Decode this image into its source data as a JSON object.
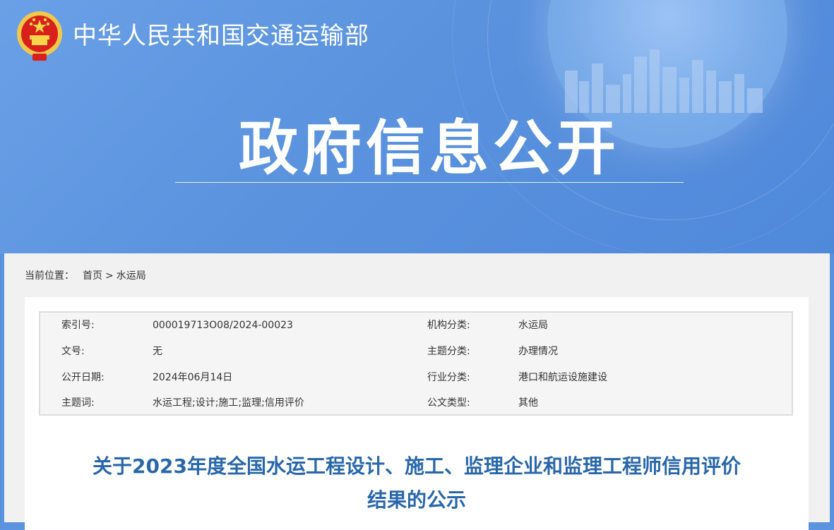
{
  "header": {
    "site_title": "中华人民共和国交通运输部",
    "banner_heading": "政府信息公开",
    "emblem_icon": "national-emblem-icon"
  },
  "breadcrumb": {
    "label": "当前位置：",
    "items": [
      "首页",
      "水运局"
    ],
    "separator": ">"
  },
  "meta": {
    "rows": [
      {
        "left_label": "索引号:",
        "left_value": "000019713O08/2024-00023",
        "right_label": "机构分类:",
        "right_value": "水运局"
      },
      {
        "left_label": "文号:",
        "left_value": "无",
        "right_label": "主题分类:",
        "right_value": "办理情况"
      },
      {
        "left_label": "公开日期:",
        "left_value": "2024年06月14日",
        "right_label": "行业分类:",
        "right_value": "港口和航运设施建设"
      },
      {
        "left_label": "主题词:",
        "left_value": "水运工程;设计;施工;监理;信用评价",
        "right_label": "公文类型:",
        "right_value": "其他"
      }
    ]
  },
  "article": {
    "title_line1": "关于2023年度全国水运工程设计、施工、监理企业和监理工程师信用评价",
    "title_line2": "结果的公示"
  },
  "colors": {
    "banner_blue": "#5a92de",
    "title_blue": "#2a67aa",
    "content_bg": "#f1f1f1"
  }
}
